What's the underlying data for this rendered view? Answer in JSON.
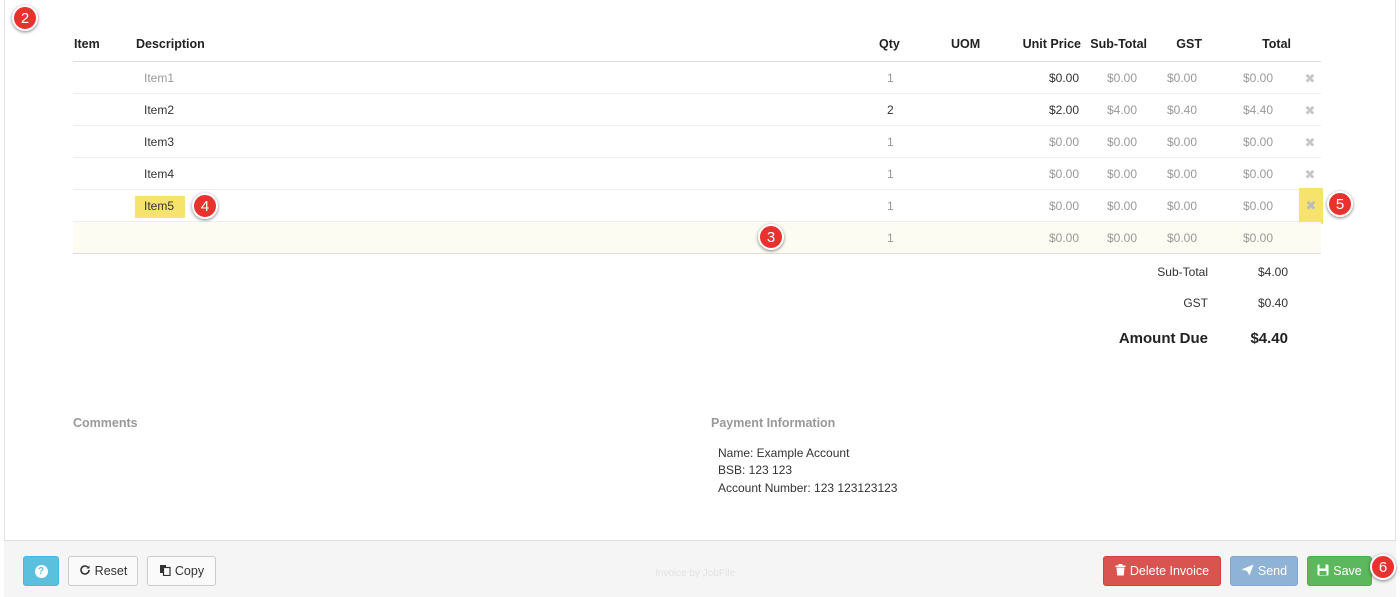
{
  "columns": {
    "item": "Item",
    "description": "Description",
    "qty": "Qty",
    "uom": "UOM",
    "unit_price": "Unit Price",
    "sub_total": "Sub-Total",
    "gst": "GST",
    "total": "Total"
  },
  "rows": [
    {
      "description": "Item1",
      "qty": "1",
      "unit_price": "$0.00",
      "sub_total": "$0.00",
      "gst": "$0.00",
      "total": "$0.00"
    },
    {
      "description": "Item2",
      "qty": "2",
      "unit_price": "$2.00",
      "sub_total": "$4.00",
      "gst": "$0.40",
      "total": "$4.40"
    },
    {
      "description": "Item3",
      "qty": "1",
      "unit_price": "$0.00",
      "sub_total": "$0.00",
      "gst": "$0.00",
      "total": "$0.00"
    },
    {
      "description": "Item4",
      "qty": "1",
      "unit_price": "$0.00",
      "sub_total": "$0.00",
      "gst": "$0.00",
      "total": "$0.00"
    },
    {
      "description": "Item5",
      "qty": "1",
      "unit_price": "$0.00",
      "sub_total": "$0.00",
      "gst": "$0.00",
      "total": "$0.00"
    },
    {
      "description": "",
      "qty": "1",
      "unit_price": "$0.00",
      "sub_total": "$0.00",
      "gst": "$0.00",
      "total": "$0.00"
    }
  ],
  "delete_glyph": "✖",
  "totals": {
    "sub_total_label": "Sub-Total",
    "sub_total_value": "$4.00",
    "gst_label": "GST",
    "gst_value": "$0.40",
    "amount_due_label": "Amount Due",
    "amount_due_value": "$4.40"
  },
  "comments": {
    "heading": "Comments"
  },
  "payment": {
    "heading": "Payment Information",
    "name": "Name: Example Account",
    "bsb": "BSB: 123 123",
    "account": "Account Number: 123 123123123"
  },
  "footer": {
    "help_icon": "?",
    "reset_label": "Reset",
    "copy_label": "Copy",
    "note": "Invoice by JobFile",
    "delete_label": "Delete Invoice",
    "send_label": "Send",
    "save_label": "Save"
  },
  "callouts": [
    "2",
    "3",
    "4",
    "5",
    "6"
  ],
  "icons": [
    "help-icon",
    "refresh-icon",
    "copy-icon",
    "trash-icon",
    "send-icon",
    "save-icon",
    "remove-icon"
  ],
  "colors": {
    "callout": "#e8322e",
    "highlight": "#f5e36b",
    "delete": "#d9534f",
    "send": "#8fb3d6",
    "save": "#5cb85c",
    "help": "#5bc0de"
  }
}
